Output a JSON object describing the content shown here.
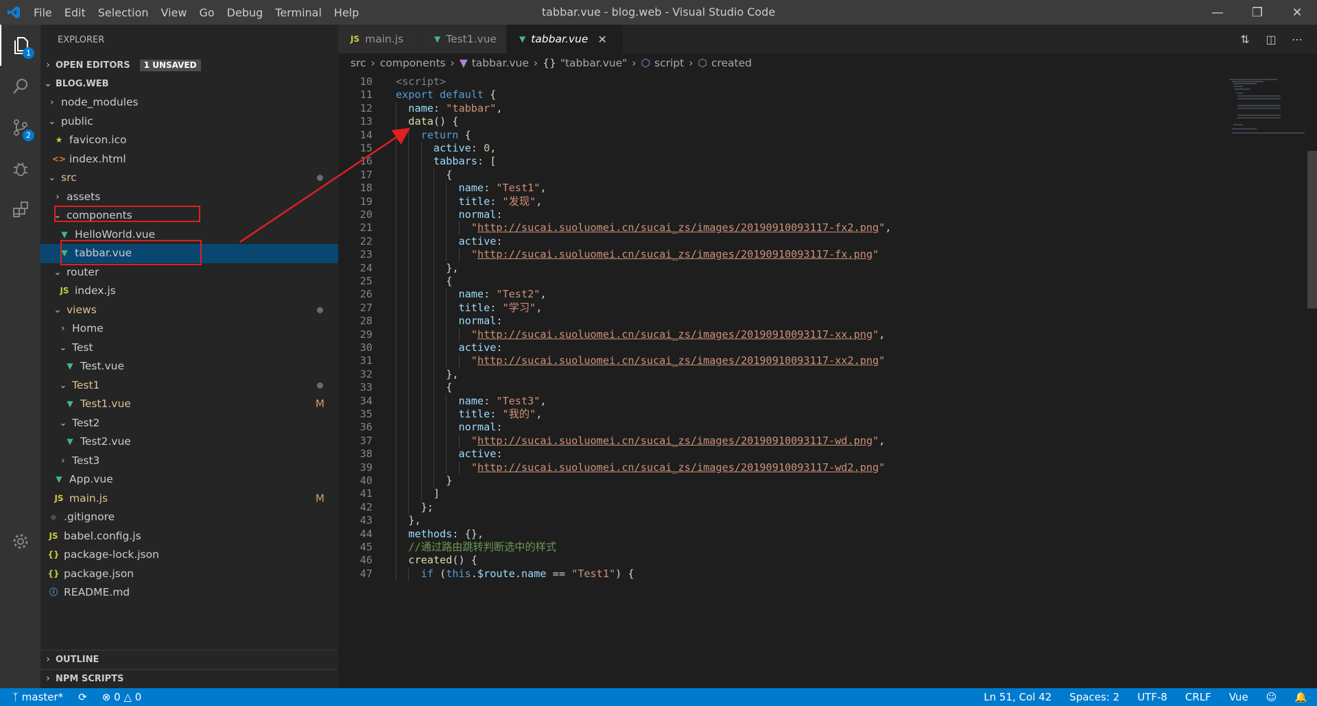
{
  "titlebar": {
    "menu": [
      "File",
      "Edit",
      "Selection",
      "View",
      "Go",
      "Debug",
      "Terminal",
      "Help"
    ],
    "window_title": "tabbar.vue - blog.web - Visual Studio Code",
    "controls": [
      "minimize-icon",
      "restore-icon",
      "close-icon"
    ]
  },
  "activity_bar": {
    "items": [
      {
        "icon": "files-icon",
        "badge": "1"
      },
      {
        "icon": "search-icon"
      },
      {
        "icon": "source-control-icon",
        "badge": "2"
      },
      {
        "icon": "debug-icon"
      },
      {
        "icon": "extensions-icon"
      }
    ],
    "bottom_icon": "gear-icon"
  },
  "sidebar": {
    "title": "EXPLORER",
    "open_editors": {
      "label": "OPEN EDITORS",
      "badge": "1 UNSAVED"
    },
    "workspace": "BLOG.WEB",
    "tree": [
      {
        "label": "node_modules",
        "type": "folder",
        "open": false,
        "depth": 0
      },
      {
        "label": "public",
        "type": "folder",
        "open": true,
        "depth": 0
      },
      {
        "label": "favicon.ico",
        "type": "star",
        "depth": 1
      },
      {
        "label": "index.html",
        "type": "html",
        "depth": 1
      },
      {
        "label": "src",
        "type": "folder",
        "open": true,
        "depth": 0,
        "modified": true,
        "dot": true
      },
      {
        "label": "assets",
        "type": "folder",
        "open": false,
        "depth": 1
      },
      {
        "label": "components",
        "type": "folder",
        "open": true,
        "depth": 1
      },
      {
        "label": "HelloWorld.vue",
        "type": "vue",
        "depth": 2
      },
      {
        "label": "tabbar.vue",
        "type": "vue",
        "depth": 2,
        "selected": true
      },
      {
        "label": "router",
        "type": "folder",
        "open": true,
        "depth": 1
      },
      {
        "label": "index.js",
        "type": "js",
        "depth": 2
      },
      {
        "label": "views",
        "type": "folder",
        "open": true,
        "depth": 1,
        "modified": true,
        "dot": true
      },
      {
        "label": "Home",
        "type": "folder",
        "open": false,
        "depth": 2
      },
      {
        "label": "Test",
        "type": "folder",
        "open": true,
        "depth": 2
      },
      {
        "label": "Test.vue",
        "type": "vue",
        "depth": 3
      },
      {
        "label": "Test1",
        "type": "folder",
        "open": true,
        "depth": 2,
        "modified": true,
        "dot": true
      },
      {
        "label": "Test1.vue",
        "type": "vue",
        "depth": 3,
        "modified": true,
        "flag": "M"
      },
      {
        "label": "Test2",
        "type": "folder",
        "open": true,
        "depth": 2
      },
      {
        "label": "Test2.vue",
        "type": "vue",
        "depth": 3
      },
      {
        "label": "Test3",
        "type": "folder",
        "open": false,
        "depth": 2
      },
      {
        "label": "App.vue",
        "type": "vue",
        "depth": 1
      },
      {
        "label": "main.js",
        "type": "js",
        "depth": 1,
        "modified": true,
        "flag": "M"
      },
      {
        "label": ".gitignore",
        "type": "git",
        "depth": 0
      },
      {
        "label": "babel.config.js",
        "type": "js",
        "depth": 0
      },
      {
        "label": "package-lock.json",
        "type": "json",
        "depth": 0
      },
      {
        "label": "package.json",
        "type": "json",
        "depth": 0
      },
      {
        "label": "README.md",
        "type": "info",
        "depth": 0
      }
    ],
    "outline": "OUTLINE",
    "npm_scripts": "NPM SCRIPTS"
  },
  "icon_glyphs": {
    "js": "JS",
    "json": "{}",
    "vue": "▼",
    "html": "<>",
    "star": "★",
    "info": "ⓘ",
    "git": "◆"
  },
  "tabs": [
    {
      "label": "main.js",
      "icon": "JS",
      "icon_type": "js",
      "active": false,
      "dirty": false
    },
    {
      "label": "Test1.vue",
      "icon": "▼",
      "icon_type": "vue",
      "active": false,
      "dirty": true
    },
    {
      "label": "tabbar.vue",
      "icon": "▼",
      "icon_type": "vue",
      "active": true,
      "close": "✕"
    }
  ],
  "breadcrumb": [
    "src",
    "components",
    "tabbar.vue",
    "\"tabbar.vue\"",
    "script",
    "created"
  ],
  "breadcrumb_icons": [
    "",
    "",
    "▼",
    "{}",
    "⬡",
    "⬡"
  ],
  "code_lines": [
    {
      "n": "10",
      "indent": 0,
      "t": [
        [
          "tag",
          "<script>"
        ]
      ]
    },
    {
      "n": "11",
      "indent": 0,
      "t": [
        [
          "kw",
          "export default"
        ],
        [
          "",
          " {"
        ]
      ]
    },
    {
      "n": "12",
      "indent": 1,
      "t": [
        [
          "prop",
          "name"
        ],
        [
          "",
          ": "
        ],
        [
          "str",
          "\"tabbar\""
        ],
        [
          "",
          ","
        ]
      ]
    },
    {
      "n": "13",
      "indent": 1,
      "t": [
        [
          "fn",
          "data"
        ],
        [
          "",
          "() {"
        ]
      ]
    },
    {
      "n": "14",
      "indent": 2,
      "t": [
        [
          "kw",
          "return"
        ],
        [
          "",
          " {"
        ]
      ]
    },
    {
      "n": "15",
      "indent": 3,
      "t": [
        [
          "prop",
          "active"
        ],
        [
          "",
          ": "
        ],
        [
          "num",
          "0"
        ],
        [
          "",
          ","
        ]
      ]
    },
    {
      "n": "16",
      "indent": 3,
      "t": [
        [
          "prop",
          "tabbars"
        ],
        [
          "",
          ": ["
        ]
      ]
    },
    {
      "n": "17",
      "indent": 4,
      "t": [
        [
          "",
          "{"
        ]
      ]
    },
    {
      "n": "18",
      "indent": 5,
      "t": [
        [
          "prop",
          "name"
        ],
        [
          "",
          ": "
        ],
        [
          "str",
          "\"Test1\""
        ],
        [
          "",
          ","
        ]
      ]
    },
    {
      "n": "19",
      "indent": 5,
      "t": [
        [
          "prop",
          "title"
        ],
        [
          "",
          ": "
        ],
        [
          "str",
          "\"发现\""
        ],
        [
          "",
          ","
        ]
      ]
    },
    {
      "n": "20",
      "indent": 5,
      "t": [
        [
          "prop",
          "normal"
        ],
        [
          "",
          ":"
        ]
      ]
    },
    {
      "n": "21",
      "indent": 6,
      "t": [
        [
          "str",
          "\""
        ],
        [
          "url",
          "http://sucai.suoluomei.cn/sucai_zs/images/20190910093117-fx2.png"
        ],
        [
          "str",
          "\""
        ],
        [
          "",
          ","
        ]
      ]
    },
    {
      "n": "22",
      "indent": 5,
      "t": [
        [
          "prop",
          "active"
        ],
        [
          "",
          ":"
        ]
      ]
    },
    {
      "n": "23",
      "indent": 6,
      "t": [
        [
          "str",
          "\""
        ],
        [
          "url",
          "http://sucai.suoluomei.cn/sucai_zs/images/20190910093117-fx.png"
        ],
        [
          "str",
          "\""
        ]
      ]
    },
    {
      "n": "24",
      "indent": 4,
      "t": [
        [
          "",
          "},"
        ]
      ]
    },
    {
      "n": "25",
      "indent": 4,
      "t": [
        [
          "",
          "{"
        ]
      ]
    },
    {
      "n": "26",
      "indent": 5,
      "t": [
        [
          "prop",
          "name"
        ],
        [
          "",
          ": "
        ],
        [
          "str",
          "\"Test2\""
        ],
        [
          "",
          ","
        ]
      ]
    },
    {
      "n": "27",
      "indent": 5,
      "t": [
        [
          "prop",
          "title"
        ],
        [
          "",
          ": "
        ],
        [
          "str",
          "\"学习\""
        ],
        [
          "",
          ","
        ]
      ]
    },
    {
      "n": "28",
      "indent": 5,
      "t": [
        [
          "prop",
          "normal"
        ],
        [
          "",
          ":"
        ]
      ]
    },
    {
      "n": "29",
      "indent": 6,
      "t": [
        [
          "str",
          "\""
        ],
        [
          "url",
          "http://sucai.suoluomei.cn/sucai_zs/images/20190910093117-xx.png"
        ],
        [
          "str",
          "\""
        ],
        [
          "",
          ","
        ]
      ]
    },
    {
      "n": "30",
      "indent": 5,
      "t": [
        [
          "prop",
          "active"
        ],
        [
          "",
          ":"
        ]
      ]
    },
    {
      "n": "31",
      "indent": 6,
      "t": [
        [
          "str",
          "\""
        ],
        [
          "url",
          "http://sucai.suoluomei.cn/sucai_zs/images/20190910093117-xx2.png"
        ],
        [
          "str",
          "\""
        ]
      ]
    },
    {
      "n": "32",
      "indent": 4,
      "t": [
        [
          "",
          "},"
        ]
      ]
    },
    {
      "n": "33",
      "indent": 4,
      "t": [
        [
          "",
          "{"
        ]
      ]
    },
    {
      "n": "34",
      "indent": 5,
      "t": [
        [
          "prop",
          "name"
        ],
        [
          "",
          ": "
        ],
        [
          "str",
          "\"Test3\""
        ],
        [
          "",
          ","
        ]
      ]
    },
    {
      "n": "35",
      "indent": 5,
      "t": [
        [
          "prop",
          "title"
        ],
        [
          "",
          ": "
        ],
        [
          "str",
          "\"我的\""
        ],
        [
          "",
          ","
        ]
      ]
    },
    {
      "n": "36",
      "indent": 5,
      "t": [
        [
          "prop",
          "normal"
        ],
        [
          "",
          ":"
        ]
      ]
    },
    {
      "n": "37",
      "indent": 6,
      "t": [
        [
          "str",
          "\""
        ],
        [
          "url",
          "http://sucai.suoluomei.cn/sucai_zs/images/20190910093117-wd.png"
        ],
        [
          "str",
          "\""
        ],
        [
          "",
          ","
        ]
      ]
    },
    {
      "n": "38",
      "indent": 5,
      "t": [
        [
          "prop",
          "active"
        ],
        [
          "",
          ":"
        ]
      ]
    },
    {
      "n": "39",
      "indent": 6,
      "t": [
        [
          "str",
          "\""
        ],
        [
          "url",
          "http://sucai.suoluomei.cn/sucai_zs/images/20190910093117-wd2.png"
        ],
        [
          "str",
          "\""
        ]
      ]
    },
    {
      "n": "40",
      "indent": 4,
      "t": [
        [
          "",
          "}"
        ]
      ]
    },
    {
      "n": "41",
      "indent": 3,
      "t": [
        [
          "",
          "]"
        ]
      ]
    },
    {
      "n": "42",
      "indent": 2,
      "t": [
        [
          "",
          "};"
        ]
      ]
    },
    {
      "n": "43",
      "indent": 1,
      "t": [
        [
          "",
          "},"
        ]
      ]
    },
    {
      "n": "44",
      "indent": 1,
      "t": [
        [
          "prop",
          "methods"
        ],
        [
          "",
          ": {},"
        ]
      ]
    },
    {
      "n": "45",
      "indent": 1,
      "t": [
        [
          "cmt",
          "//通过路由跳转判断选中的样式"
        ]
      ]
    },
    {
      "n": "46",
      "indent": 1,
      "t": [
        [
          "fn",
          "created"
        ],
        [
          "",
          "() {"
        ]
      ]
    },
    {
      "n": "47",
      "indent": 2,
      "t": [
        [
          "kw",
          "if"
        ],
        [
          "",
          " ("
        ],
        [
          "kw",
          "this"
        ],
        [
          "",
          "."
        ],
        [
          "prop",
          "$route"
        ],
        [
          "",
          "."
        ],
        [
          "prop",
          "name"
        ],
        [
          "",
          " == "
        ],
        [
          "str",
          "\"Test1\""
        ],
        [
          "",
          ") {"
        ]
      ]
    }
  ],
  "statusbar": {
    "branch": "master*",
    "sync_icon": "sync-icon",
    "errors": "0",
    "warnings": "0",
    "position": "Ln 51, Col 42",
    "spaces": "Spaces: 2",
    "encoding": "UTF-8",
    "eol": "CRLF",
    "language": "Vue",
    "feedback_icon": "feedback-icon",
    "bell_icon": "bell-icon"
  },
  "annotation": {
    "color": "#e02020"
  }
}
